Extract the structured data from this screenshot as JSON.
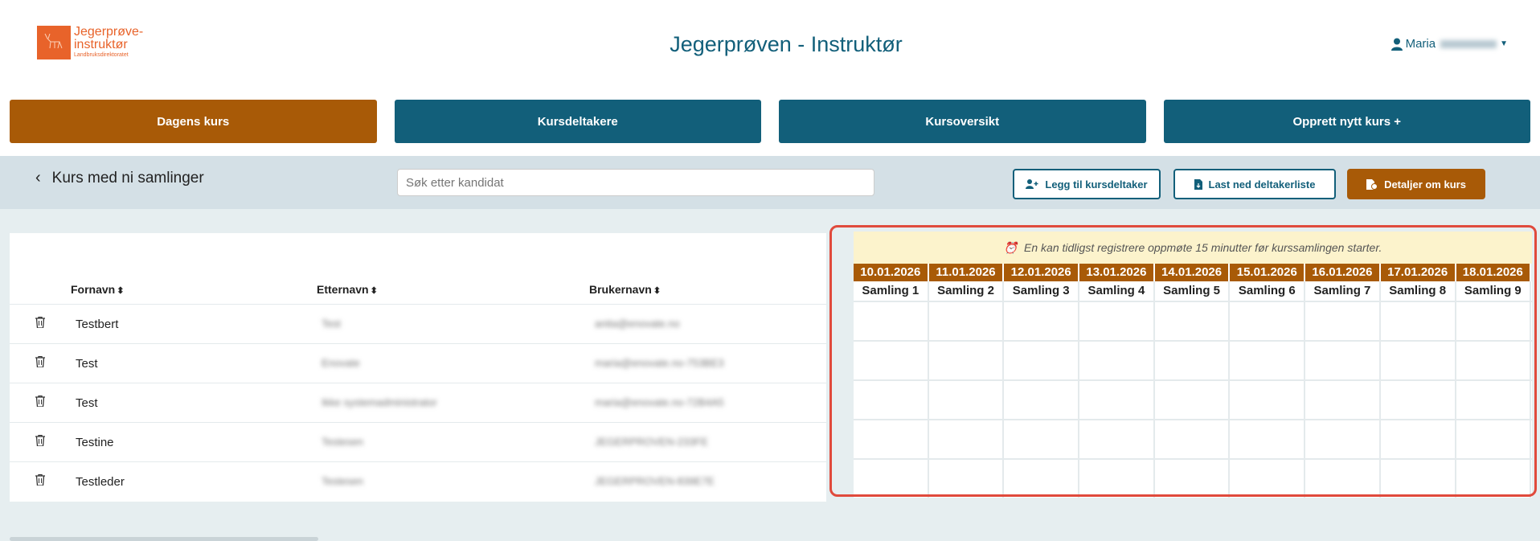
{
  "brand": {
    "logo_line1": "Jegerprøve-",
    "logo_line2": "instruktør",
    "logo_line3": "Landbruksdirektoratet"
  },
  "app_title": "Jegerprøven - Instruktør",
  "user": {
    "name": "Maria"
  },
  "nav": [
    {
      "label": "Dagens kurs",
      "color": "#a85a07"
    },
    {
      "label": "Kursdeltakere",
      "color": "#125f7a"
    },
    {
      "label": "Kursoversikt",
      "color": "#125f7a"
    },
    {
      "label": "Opprett nytt kurs +",
      "color": "#125f7a"
    }
  ],
  "toolbar": {
    "course_title": "Kurs med ni samlinger",
    "search_placeholder": "Søk etter kandidat",
    "add_participant_label": "Legg til kursdeltaker",
    "download_list_label": "Last ned deltakerliste",
    "course_details_label": "Detaljer om kurs"
  },
  "table": {
    "headers": {
      "first_name": "Fornavn",
      "last_name": "Etternavn",
      "username": "Brukernavn"
    },
    "rows": [
      {
        "first_name": "Testbert",
        "last_name": "Test",
        "username": "anita@enovate.no"
      },
      {
        "first_name": "Test",
        "last_name": "Enovate",
        "username": "maria@enovate.no-753BE3"
      },
      {
        "first_name": "Test",
        "last_name": "Ikke systemadministrator",
        "username": "maria@enovate.no-72B4A5"
      },
      {
        "first_name": "Testine",
        "last_name": "Testesen",
        "username": "JEGERPROVEN-233FE"
      },
      {
        "first_name": "Testleder",
        "last_name": "Testesen",
        "username": "JEGERPROVEN-839E7E"
      }
    ]
  },
  "attendance": {
    "notice": "En kan tidligst registrere oppmøte 15 minutter før kurssamlingen starter.",
    "sessions": [
      {
        "date": "10.01.2026",
        "label": "Samling 1"
      },
      {
        "date": "11.01.2026",
        "label": "Samling 2"
      },
      {
        "date": "12.01.2026",
        "label": "Samling 3"
      },
      {
        "date": "13.01.2026",
        "label": "Samling 4"
      },
      {
        "date": "14.01.2026",
        "label": "Samling 5"
      },
      {
        "date": "15.01.2026",
        "label": "Samling 6"
      },
      {
        "date": "16.01.2026",
        "label": "Samling 7"
      },
      {
        "date": "17.01.2026",
        "label": "Samling 8"
      },
      {
        "date": "18.01.2026",
        "label": "Samling 9"
      }
    ]
  },
  "colors": {
    "primary": "#125f7a",
    "accent": "#a85a07",
    "highlight": "#e04a3c"
  }
}
